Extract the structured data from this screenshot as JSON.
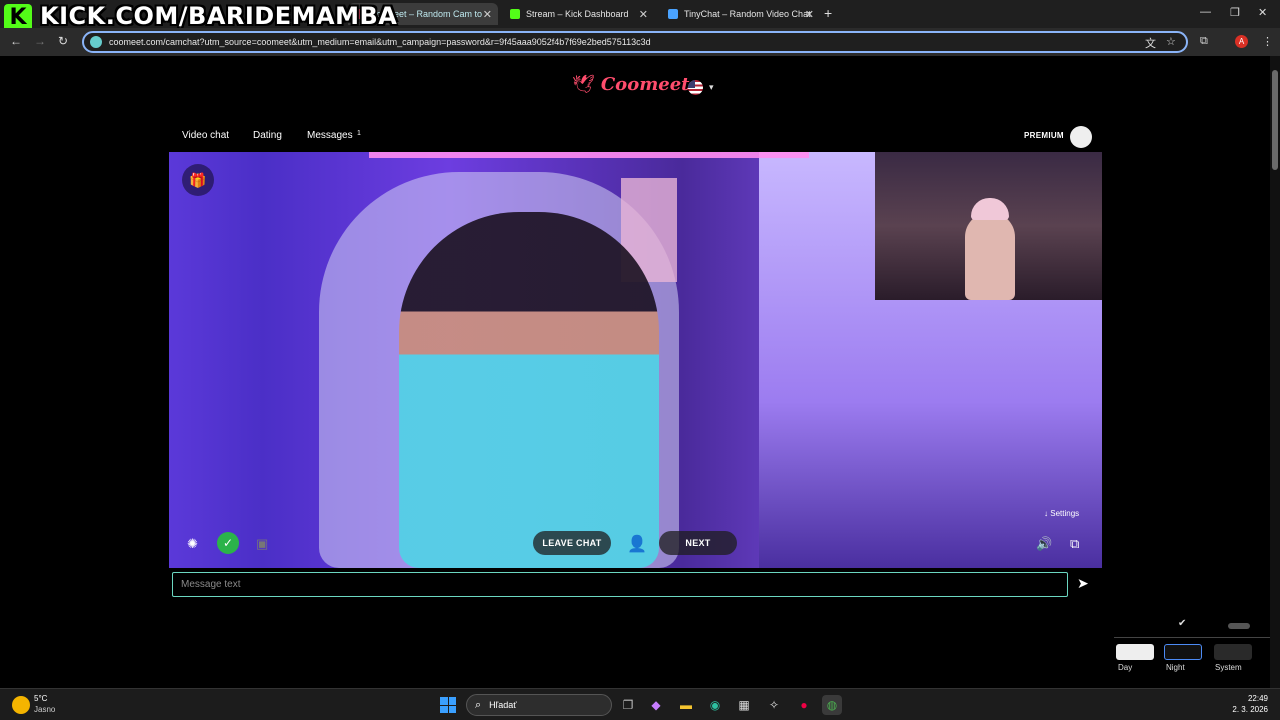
{
  "overlay": {
    "logo_letter": "K",
    "stream_text": "KICK.COM/BARIDEMAMBA"
  },
  "tabs": [
    {
      "title": "Coomeet – Random Cam to",
      "active": true
    },
    {
      "title": "Stream – Kick Dashboard",
      "active": false
    },
    {
      "title": "TinyChat – Random Video Chat",
      "active": false
    }
  ],
  "browser": {
    "url": "coomeet.com/camchat?utm_source=coomeet&utm_medium=email&utm_campaign=password&r=9f45aaa9052f4b7f69e2bed575113c3d",
    "profile_initial": "A"
  },
  "site": {
    "brand": "Coomeet",
    "nav": [
      {
        "label": "Video chat"
      },
      {
        "label": "Dating"
      },
      {
        "label": "Messages"
      }
    ],
    "messages_badge": "1",
    "premium_label": "PREMIUM"
  },
  "video": {
    "leave_chat_label": "LEAVE CHAT",
    "next_label": "NEXT",
    "settings_label": "Settings"
  },
  "chat": {
    "placeholder": "Message text"
  },
  "theme": {
    "options": [
      {
        "label": "Day"
      },
      {
        "label": "Night"
      },
      {
        "label": "System"
      }
    ],
    "selected": "Night"
  },
  "taskbar": {
    "temperature": "5°C",
    "condition": "Jasno",
    "search_label": "Hľadať",
    "time": "22:49",
    "date": "2. 3. 2026"
  }
}
